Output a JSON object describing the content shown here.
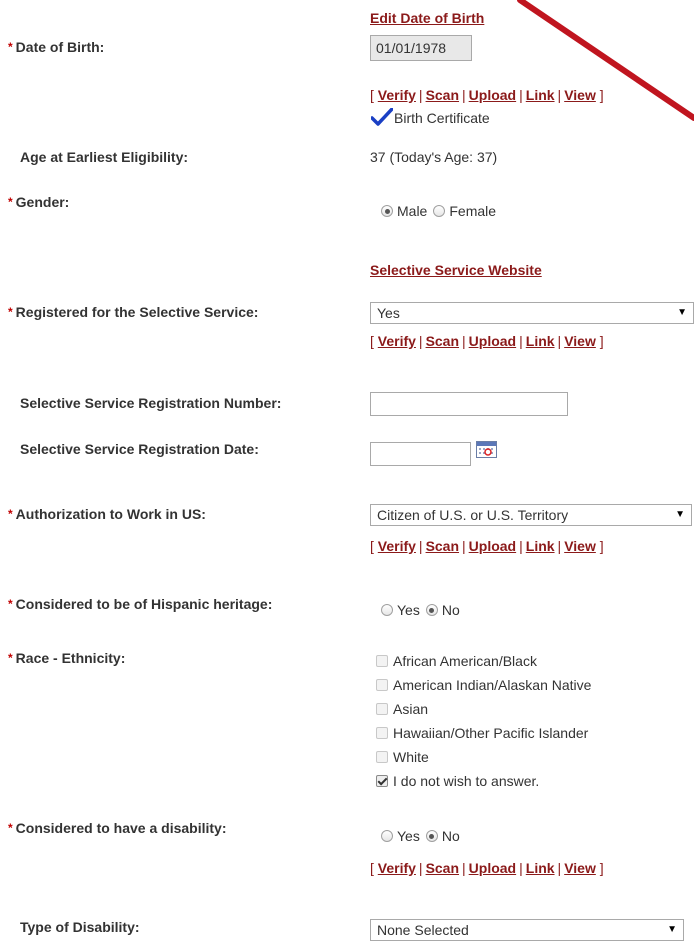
{
  "dob": {
    "edit_link": "Edit Date of Birth",
    "label": "Date of Birth:",
    "value": "01/01/1978",
    "doc_label": "Birth Certificate"
  },
  "actions": {
    "verify": "Verify",
    "scan": "Scan",
    "upload": "Upload",
    "link": "Link",
    "view": "View"
  },
  "age": {
    "label": "Age at Earliest Eligibility:",
    "value": "37 (Today's Age: 37)"
  },
  "gender": {
    "label": "Gender:",
    "options": [
      "Male",
      "Female"
    ],
    "selected": "Male"
  },
  "selective_service": {
    "website_link": "Selective Service Website",
    "registered_label": "Registered for the Selective Service:",
    "registered_value": "Yes",
    "reg_number_label": "Selective Service Registration Number:",
    "reg_number_value": "",
    "reg_date_label": "Selective Service Registration Date:",
    "reg_date_value": ""
  },
  "work_auth": {
    "label": "Authorization to Work in US:",
    "value": "Citizen of U.S. or U.S. Territory"
  },
  "hispanic": {
    "label": "Considered to be of Hispanic heritage:",
    "options": [
      "Yes",
      "No"
    ],
    "selected": "No"
  },
  "race": {
    "label": "Race - Ethnicity:",
    "options": [
      {
        "label": "African American/Black",
        "checked": false
      },
      {
        "label": "American Indian/Alaskan Native",
        "checked": false
      },
      {
        "label": "Asian",
        "checked": false
      },
      {
        "label": "Hawaiian/Other Pacific Islander",
        "checked": false
      },
      {
        "label": "White",
        "checked": false
      },
      {
        "label": "I do not wish to answer.",
        "checked": true
      }
    ]
  },
  "disability": {
    "label": "Considered to have a disability:",
    "options": [
      "Yes",
      "No"
    ],
    "selected": "No",
    "type_label": "Type of Disability:",
    "type_value": "None Selected"
  },
  "colors": {
    "required": "#c00000",
    "link": "#8b1a1a",
    "annotation_arrow": "#c0151f"
  }
}
